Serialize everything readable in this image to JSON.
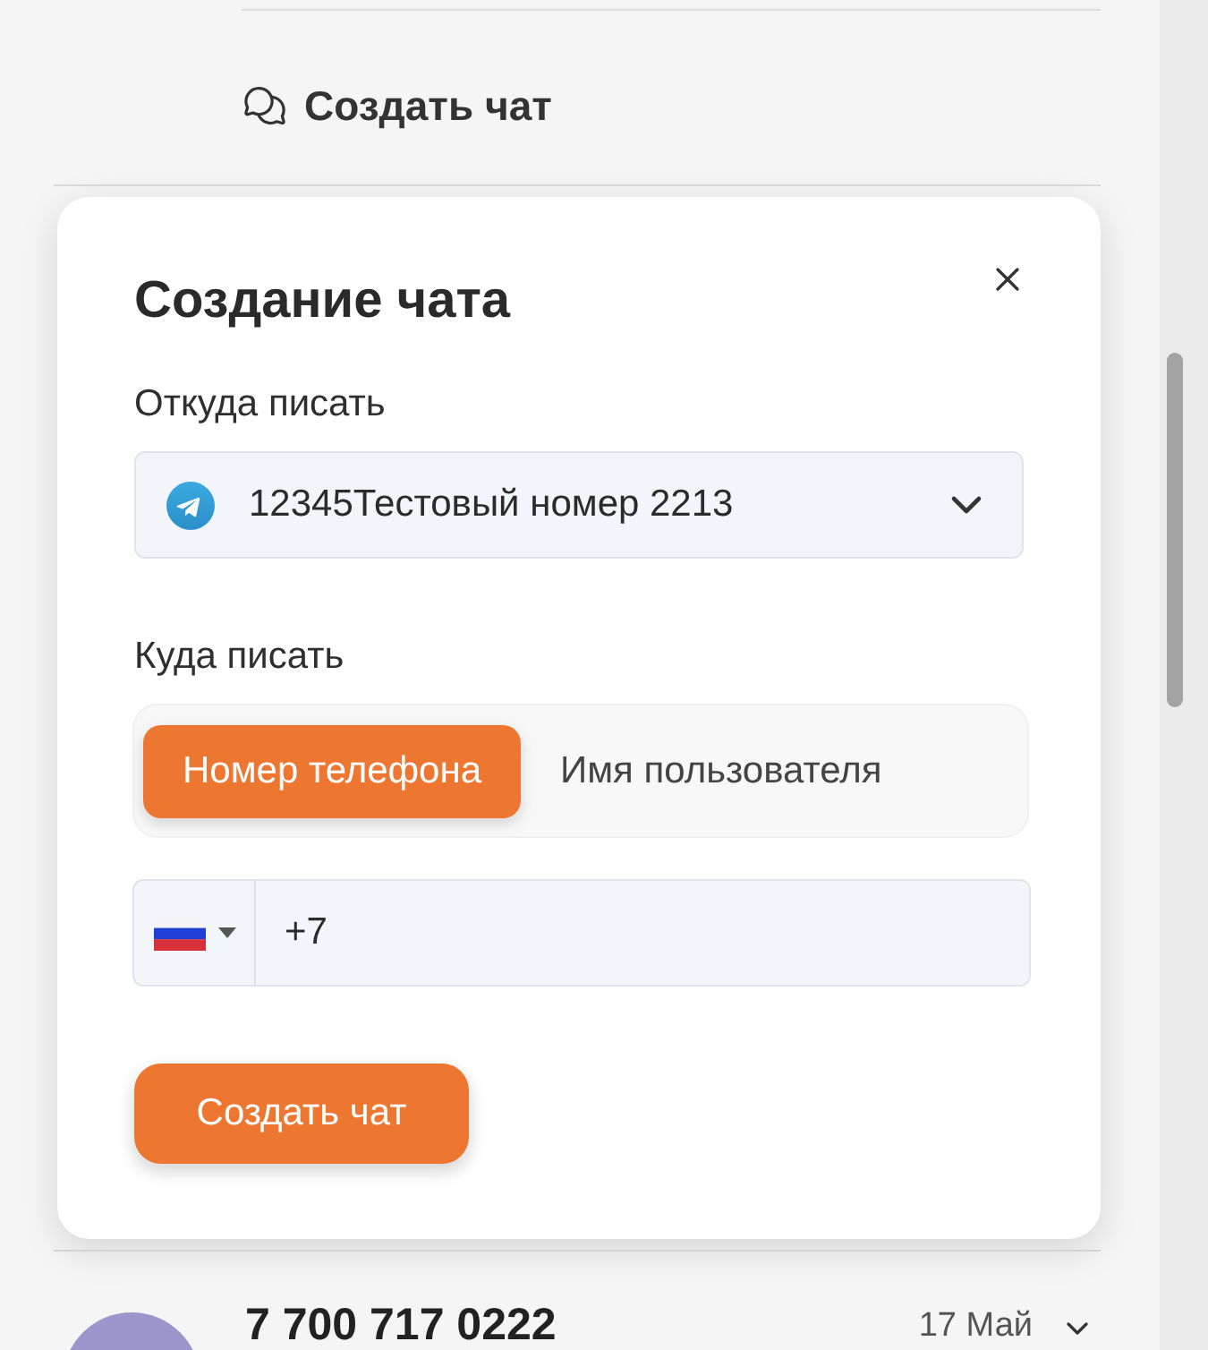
{
  "list": {
    "top_action": {
      "label": "Создать чат"
    }
  },
  "dialog": {
    "title": "Создание чата",
    "source": {
      "label": "Откуда писать",
      "value": "12345Тестовый номер 2213"
    },
    "target": {
      "label": "Куда писать",
      "tabs": [
        {
          "label": "Номер телефона",
          "selected": true
        },
        {
          "label": "Имя пользователя",
          "selected": false
        }
      ],
      "phone": {
        "value": "+7"
      }
    },
    "submit": {
      "label": "Создать чат"
    }
  },
  "chat_list": [
    {
      "name": "7 700 717 0222",
      "date": "17 Май"
    }
  ]
}
